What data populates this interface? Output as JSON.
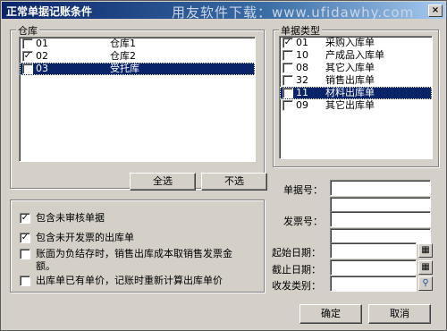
{
  "window": {
    "title": "正常单据记账条件",
    "watermark": "用友软件下载：www.ufidawhy.com",
    "close_glyph": "×"
  },
  "warehouse": {
    "group_label": "仓库",
    "items": [
      {
        "code": "01",
        "name": "仓库1",
        "checked": false,
        "selected": false
      },
      {
        "code": "02",
        "name": "仓库2",
        "checked": true,
        "selected": false
      },
      {
        "code": "03",
        "name": "受托库",
        "checked": false,
        "selected": true
      }
    ],
    "select_all_label": "全选",
    "deselect_label": "不选"
  },
  "doc_type": {
    "group_label": "单据类型",
    "items": [
      {
        "code": "01",
        "name": "采购入库单",
        "checked": true,
        "selected": false
      },
      {
        "code": "10",
        "name": "产成品入库单",
        "checked": false,
        "selected": false
      },
      {
        "code": "08",
        "name": "其它入库单",
        "checked": false,
        "selected": false
      },
      {
        "code": "32",
        "name": "销售出库单",
        "checked": false,
        "selected": false
      },
      {
        "code": "11",
        "name": "材料出库单",
        "checked": false,
        "selected": true
      },
      {
        "code": "09",
        "name": "其它出库单",
        "checked": false,
        "selected": false
      }
    ]
  },
  "options": [
    {
      "label": "包含未审核单据",
      "checked": true
    },
    {
      "label": "包含未开发票的出库单",
      "checked": true
    },
    {
      "label": "账面为负结存时，销售出库成本取销售发票金额。",
      "checked": false
    },
    {
      "label": "出库单已有单价，记账时重新计算出库单价",
      "checked": false
    }
  ],
  "fields": {
    "doc_no_label": "单据号：",
    "invoice_no_label": "发票号：",
    "start_date_label": "起始日期：",
    "end_date_label": "截止日期：",
    "category_label": "收发类别："
  },
  "icons": {
    "calendar": "calendar-icon",
    "search": "search-icon"
  },
  "buttons": {
    "ok_label": "确定",
    "cancel_label": "取消"
  }
}
